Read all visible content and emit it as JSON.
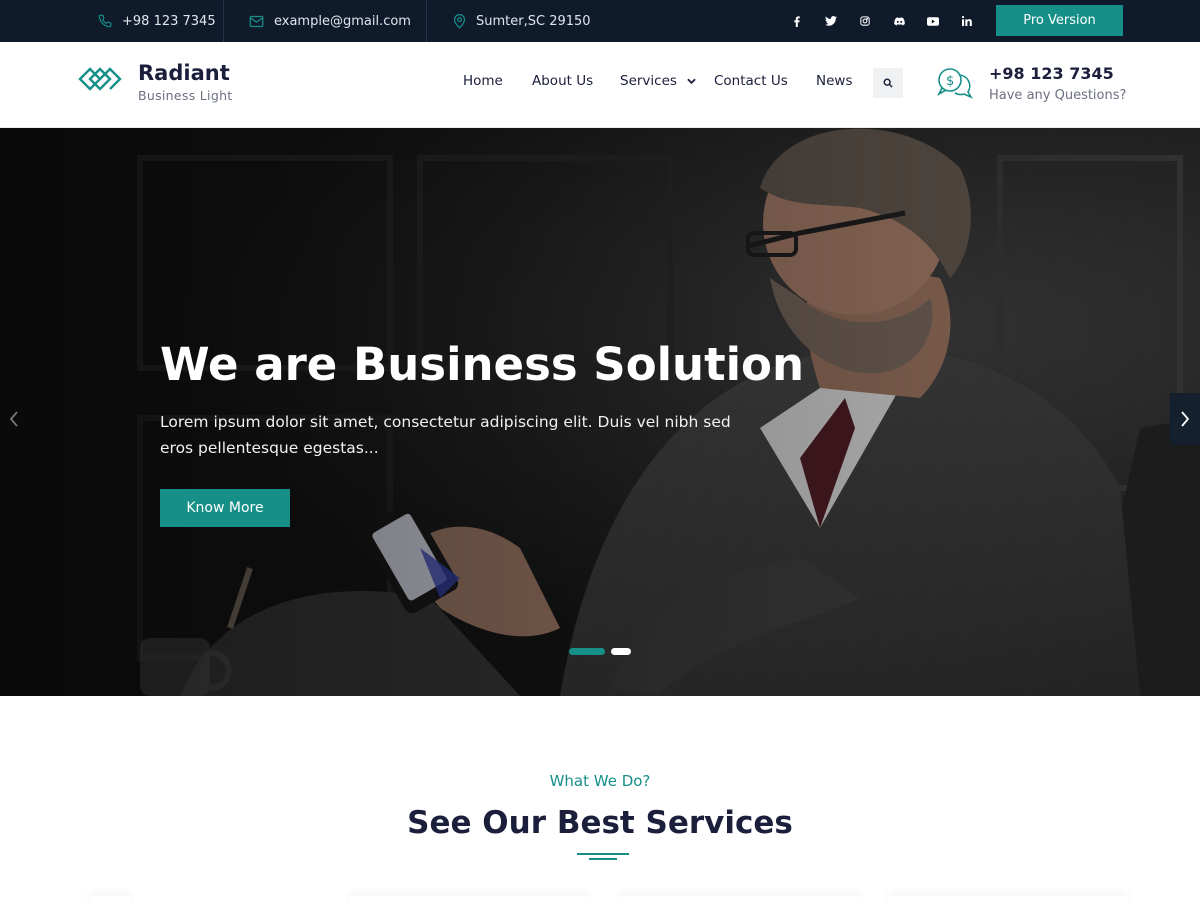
{
  "topbar": {
    "phone": "+98 123 7345",
    "email": "example@gmail.com",
    "address": "Sumter,SC 29150",
    "socials": [
      "facebook-icon",
      "twitter-icon",
      "instagram-icon",
      "discord-icon",
      "youtube-icon",
      "linkedin-icon"
    ],
    "pro_button": "Pro Version"
  },
  "header": {
    "logo_title": "Radiant",
    "logo_subtitle": "Business Light",
    "nav": [
      "Home",
      "About Us",
      "Services",
      "Contact Us",
      "News"
    ],
    "call_number": "+98 123 7345",
    "call_subtitle": "Have any Questions?"
  },
  "hero": {
    "title": "We are Business Solution",
    "text": "Lorem ipsum dolor sit amet, consectetur adipiscing elit. Duis vel nibh sed eros pellentesque egestas...",
    "button": "Know More",
    "active_slide": 1,
    "slide_count": 2
  },
  "services": {
    "kicker": "What We Do?",
    "title": "See Our Best Services"
  },
  "colors": {
    "accent": "#168f89",
    "topbar_bg": "#0f1b2b",
    "heading": "#1b1f3b"
  }
}
